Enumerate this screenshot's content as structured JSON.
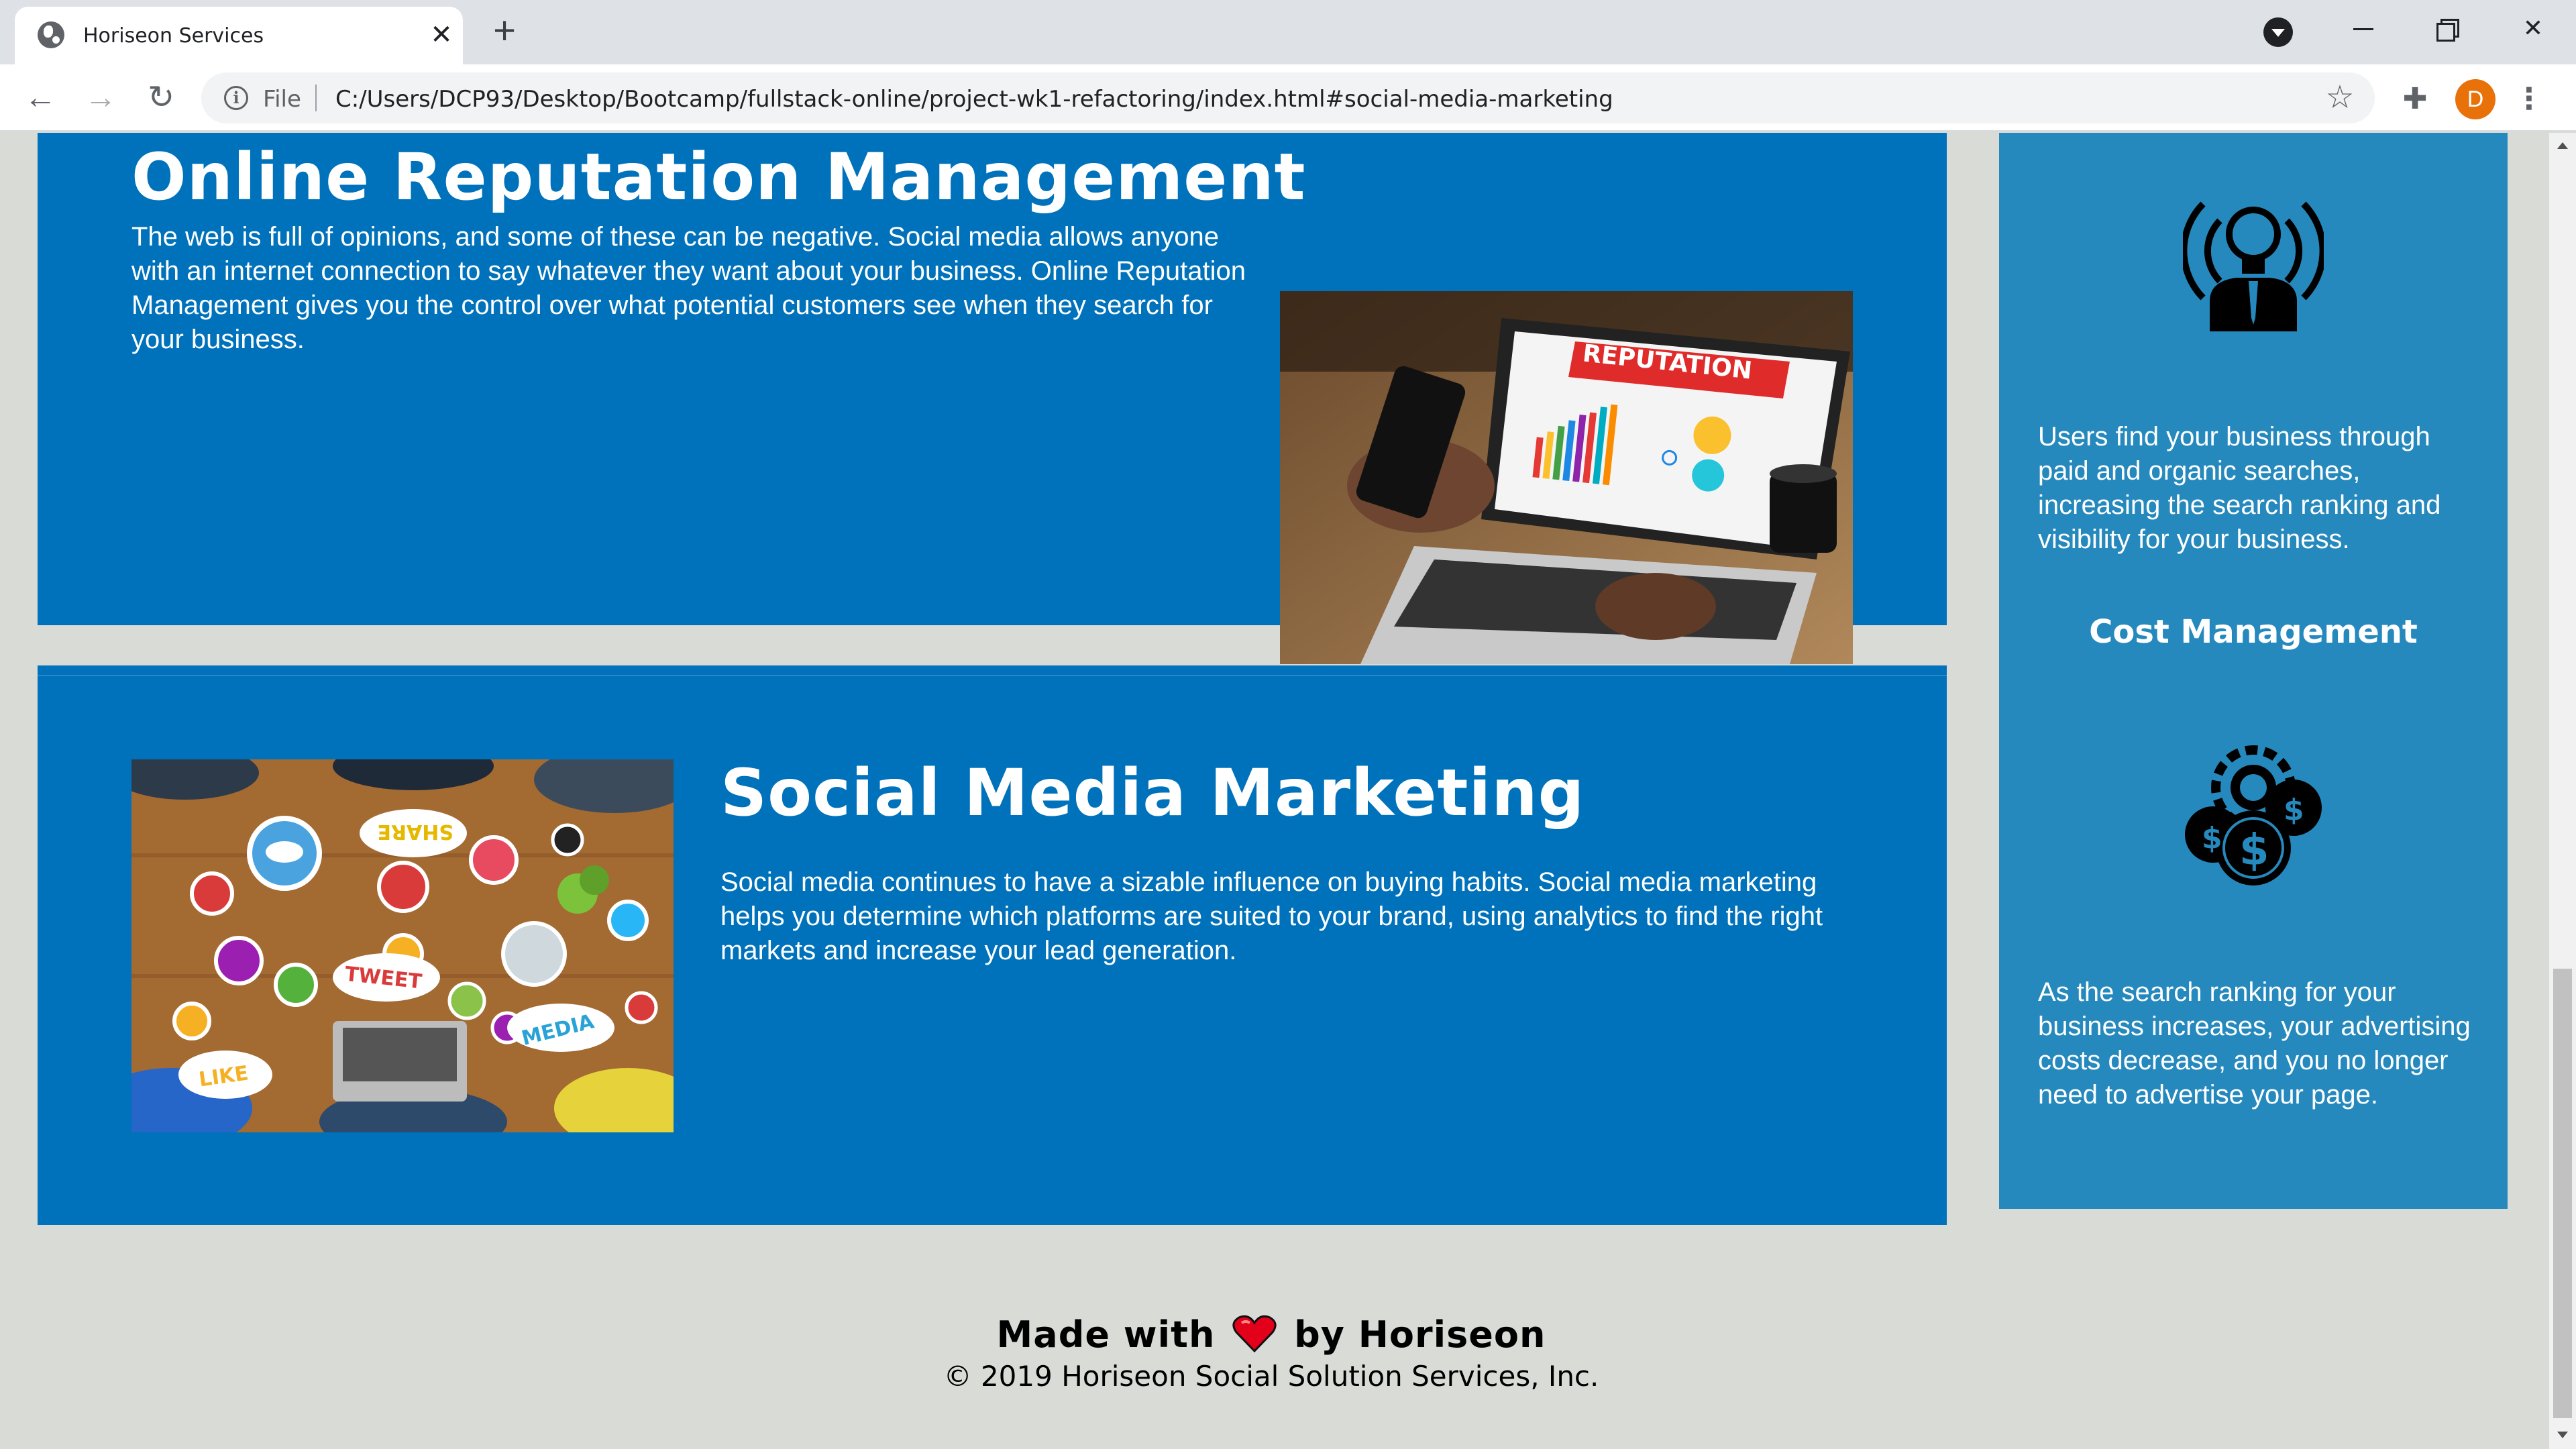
{
  "browser": {
    "tab_title": "Horiseon Services",
    "tab_close": "✕",
    "new_tab": "+",
    "file_label": "File",
    "url": "C:/Users/DCP93/Desktop/Bootcamp/fullstack-online/project-wk1-refactoring/index.html#social-media-marketing",
    "profile_initial": "D",
    "back_glyph": "←",
    "forward_glyph": "→",
    "reload_glyph": "↻",
    "star_glyph": "☆",
    "extensions_glyph": "✚",
    "menu_glyph": "⋮",
    "info_glyph": "i"
  },
  "sections": [
    {
      "id": "online-reputation-management",
      "title": "Online Reputation Management",
      "text": "The web is full of opinions, and some of these can be negative. Social media allows anyone with an internet connection to say whatever they want about your business. Online Reputation Management gives you the control over what potential customers see when they search for your business.",
      "image": {
        "banner_text": "REPUTATION"
      }
    },
    {
      "id": "social-media-marketing",
      "title": "Social Media Marketing",
      "text": "Social media continues to have a sizable influence on buying habits. Social media marketing helps you determine which platforms are suited to your brand, using analytics to find the right markets and increase your lead generation.",
      "image": {
        "bubbles": [
          "SHARE",
          "TWEET",
          "LIKE",
          "MEDIA"
        ]
      }
    }
  ],
  "sidebar": {
    "lead_text": "Users find your business through paid and organic searches, increasing the search ranking and visibility for your business.",
    "cost_heading": "Cost Management",
    "cost_text": "As the search ranking for your business increases, your advertising costs decrease, and you no longer need to advertise your page.",
    "icons": [
      "lightbulb-person-icon",
      "cost-gear-coins-icon"
    ]
  },
  "footer": {
    "made_with": "Made with",
    "by": "by Horiseon",
    "copyright": "© 2019 Horiseon Social Solution Services, Inc."
  },
  "colors": {
    "panel_blue": "#0072bb",
    "sidebar_blue": "#2589bd",
    "page_background": "#d9dbd7",
    "heart_red": "#e3001b"
  }
}
